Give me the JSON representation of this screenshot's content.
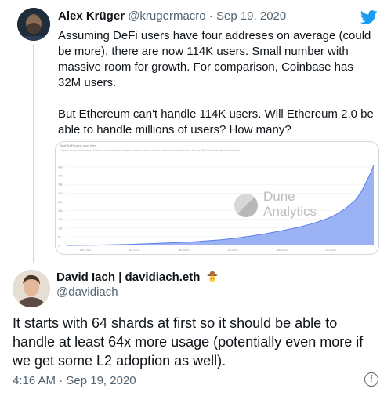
{
  "quoted_tweet": {
    "author_name": "Alex Krüger",
    "author_handle": "@krugermacro",
    "separator": "·",
    "date": "Sep 19, 2020",
    "paragraph_1": "Assuming DeFi users have four addreses on average (could be more), there are now 114K users. Small number with massive room for growth. For comparison, Coinbase has 32M users.",
    "paragraph_2": "But Ethereum can't handle 114K users. Will Ethereum 2.0 be able to handle millions of users? How many?",
    "platform_icon": "twitter-bird-icon",
    "brand_color": "#1d9bf0"
  },
  "embedded_chart": {
    "title": "Total DeFi users over time",
    "subtitle": "Users = unique addresses. Since a user can have multiple addresses the numbers below are overestimates. Source: Richard Chen @richardchen39",
    "watermark_line1": "Dune",
    "watermark_line2": "Analytics",
    "fill_color": "#8aa6f2",
    "line_color": "#5b7ee8"
  },
  "chart_data": {
    "type": "area",
    "title": "Total DeFi users over time",
    "x_tick_labels": [
      "Jan 2019",
      "Jul 2019",
      "Jan 2020",
      "Jul 2019",
      "Jan 2020",
      "Jul 2020"
    ],
    "y_tick_labels": [
      "45k",
      "40k",
      "35k",
      "30k",
      "25k",
      "20k",
      "15k",
      "10k",
      "5k",
      "0"
    ],
    "ylim": [
      0,
      45000
    ],
    "grid": true,
    "x": [
      0,
      0.1,
      0.2,
      0.3,
      0.4,
      0.5,
      0.55,
      0.6,
      0.65,
      0.7,
      0.75,
      0.8,
      0.85,
      0.88,
      0.91,
      0.94,
      0.96,
      0.98,
      1.0
    ],
    "values": [
      0,
      200,
      600,
      1200,
      2000,
      3200,
      4200,
      5400,
      6800,
      8400,
      10200,
      12500,
      15500,
      18000,
      21500,
      26000,
      31000,
      38000,
      46000
    ]
  },
  "reply_tweet": {
    "author_name": "David Iach | davidiach.eth",
    "author_emoji": "cowboy-emoji",
    "author_handle": "@davidiach",
    "text": "It starts with 64 shards at first so it should be able to handle at least 64x more usage (potentially even more if we get some L2 adoption as well).",
    "timestamp": "4:16 AM · Sep 19, 2020",
    "info_icon": "info-icon",
    "info_glyph": "i"
  }
}
